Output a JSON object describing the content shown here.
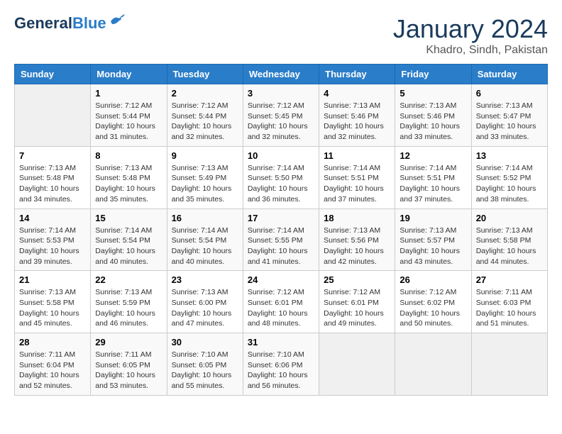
{
  "header": {
    "logo_general": "General",
    "logo_blue": "Blue",
    "month_title": "January 2024",
    "subtitle": "Khadro, Sindh, Pakistan"
  },
  "days_of_week": [
    "Sunday",
    "Monday",
    "Tuesday",
    "Wednesday",
    "Thursday",
    "Friday",
    "Saturday"
  ],
  "weeks": [
    [
      {
        "day": "",
        "sunrise": "",
        "sunset": "",
        "daylight": "",
        "empty": true
      },
      {
        "day": "1",
        "sunrise": "Sunrise: 7:12 AM",
        "sunset": "Sunset: 5:44 PM",
        "daylight": "Daylight: 10 hours and 31 minutes."
      },
      {
        "day": "2",
        "sunrise": "Sunrise: 7:12 AM",
        "sunset": "Sunset: 5:44 PM",
        "daylight": "Daylight: 10 hours and 32 minutes."
      },
      {
        "day": "3",
        "sunrise": "Sunrise: 7:12 AM",
        "sunset": "Sunset: 5:45 PM",
        "daylight": "Daylight: 10 hours and 32 minutes."
      },
      {
        "day": "4",
        "sunrise": "Sunrise: 7:13 AM",
        "sunset": "Sunset: 5:46 PM",
        "daylight": "Daylight: 10 hours and 32 minutes."
      },
      {
        "day": "5",
        "sunrise": "Sunrise: 7:13 AM",
        "sunset": "Sunset: 5:46 PM",
        "daylight": "Daylight: 10 hours and 33 minutes."
      },
      {
        "day": "6",
        "sunrise": "Sunrise: 7:13 AM",
        "sunset": "Sunset: 5:47 PM",
        "daylight": "Daylight: 10 hours and 33 minutes."
      }
    ],
    [
      {
        "day": "7",
        "sunrise": "Sunrise: 7:13 AM",
        "sunset": "Sunset: 5:48 PM",
        "daylight": "Daylight: 10 hours and 34 minutes."
      },
      {
        "day": "8",
        "sunrise": "Sunrise: 7:13 AM",
        "sunset": "Sunset: 5:48 PM",
        "daylight": "Daylight: 10 hours and 35 minutes."
      },
      {
        "day": "9",
        "sunrise": "Sunrise: 7:13 AM",
        "sunset": "Sunset: 5:49 PM",
        "daylight": "Daylight: 10 hours and 35 minutes."
      },
      {
        "day": "10",
        "sunrise": "Sunrise: 7:14 AM",
        "sunset": "Sunset: 5:50 PM",
        "daylight": "Daylight: 10 hours and 36 minutes."
      },
      {
        "day": "11",
        "sunrise": "Sunrise: 7:14 AM",
        "sunset": "Sunset: 5:51 PM",
        "daylight": "Daylight: 10 hours and 37 minutes."
      },
      {
        "day": "12",
        "sunrise": "Sunrise: 7:14 AM",
        "sunset": "Sunset: 5:51 PM",
        "daylight": "Daylight: 10 hours and 37 minutes."
      },
      {
        "day": "13",
        "sunrise": "Sunrise: 7:14 AM",
        "sunset": "Sunset: 5:52 PM",
        "daylight": "Daylight: 10 hours and 38 minutes."
      }
    ],
    [
      {
        "day": "14",
        "sunrise": "Sunrise: 7:14 AM",
        "sunset": "Sunset: 5:53 PM",
        "daylight": "Daylight: 10 hours and 39 minutes."
      },
      {
        "day": "15",
        "sunrise": "Sunrise: 7:14 AM",
        "sunset": "Sunset: 5:54 PM",
        "daylight": "Daylight: 10 hours and 40 minutes."
      },
      {
        "day": "16",
        "sunrise": "Sunrise: 7:14 AM",
        "sunset": "Sunset: 5:54 PM",
        "daylight": "Daylight: 10 hours and 40 minutes."
      },
      {
        "day": "17",
        "sunrise": "Sunrise: 7:14 AM",
        "sunset": "Sunset: 5:55 PM",
        "daylight": "Daylight: 10 hours and 41 minutes."
      },
      {
        "day": "18",
        "sunrise": "Sunrise: 7:13 AM",
        "sunset": "Sunset: 5:56 PM",
        "daylight": "Daylight: 10 hours and 42 minutes."
      },
      {
        "day": "19",
        "sunrise": "Sunrise: 7:13 AM",
        "sunset": "Sunset: 5:57 PM",
        "daylight": "Daylight: 10 hours and 43 minutes."
      },
      {
        "day": "20",
        "sunrise": "Sunrise: 7:13 AM",
        "sunset": "Sunset: 5:58 PM",
        "daylight": "Daylight: 10 hours and 44 minutes."
      }
    ],
    [
      {
        "day": "21",
        "sunrise": "Sunrise: 7:13 AM",
        "sunset": "Sunset: 5:58 PM",
        "daylight": "Daylight: 10 hours and 45 minutes."
      },
      {
        "day": "22",
        "sunrise": "Sunrise: 7:13 AM",
        "sunset": "Sunset: 5:59 PM",
        "daylight": "Daylight: 10 hours and 46 minutes."
      },
      {
        "day": "23",
        "sunrise": "Sunrise: 7:13 AM",
        "sunset": "Sunset: 6:00 PM",
        "daylight": "Daylight: 10 hours and 47 minutes."
      },
      {
        "day": "24",
        "sunrise": "Sunrise: 7:12 AM",
        "sunset": "Sunset: 6:01 PM",
        "daylight": "Daylight: 10 hours and 48 minutes."
      },
      {
        "day": "25",
        "sunrise": "Sunrise: 7:12 AM",
        "sunset": "Sunset: 6:01 PM",
        "daylight": "Daylight: 10 hours and 49 minutes."
      },
      {
        "day": "26",
        "sunrise": "Sunrise: 7:12 AM",
        "sunset": "Sunset: 6:02 PM",
        "daylight": "Daylight: 10 hours and 50 minutes."
      },
      {
        "day": "27",
        "sunrise": "Sunrise: 7:11 AM",
        "sunset": "Sunset: 6:03 PM",
        "daylight": "Daylight: 10 hours and 51 minutes."
      }
    ],
    [
      {
        "day": "28",
        "sunrise": "Sunrise: 7:11 AM",
        "sunset": "Sunset: 6:04 PM",
        "daylight": "Daylight: 10 hours and 52 minutes."
      },
      {
        "day": "29",
        "sunrise": "Sunrise: 7:11 AM",
        "sunset": "Sunset: 6:05 PM",
        "daylight": "Daylight: 10 hours and 53 minutes."
      },
      {
        "day": "30",
        "sunrise": "Sunrise: 7:10 AM",
        "sunset": "Sunset: 6:05 PM",
        "daylight": "Daylight: 10 hours and 55 minutes."
      },
      {
        "day": "31",
        "sunrise": "Sunrise: 7:10 AM",
        "sunset": "Sunset: 6:06 PM",
        "daylight": "Daylight: 10 hours and 56 minutes."
      },
      {
        "day": "",
        "sunrise": "",
        "sunset": "",
        "daylight": "",
        "empty": true
      },
      {
        "day": "",
        "sunrise": "",
        "sunset": "",
        "daylight": "",
        "empty": true
      },
      {
        "day": "",
        "sunrise": "",
        "sunset": "",
        "daylight": "",
        "empty": true
      }
    ]
  ]
}
